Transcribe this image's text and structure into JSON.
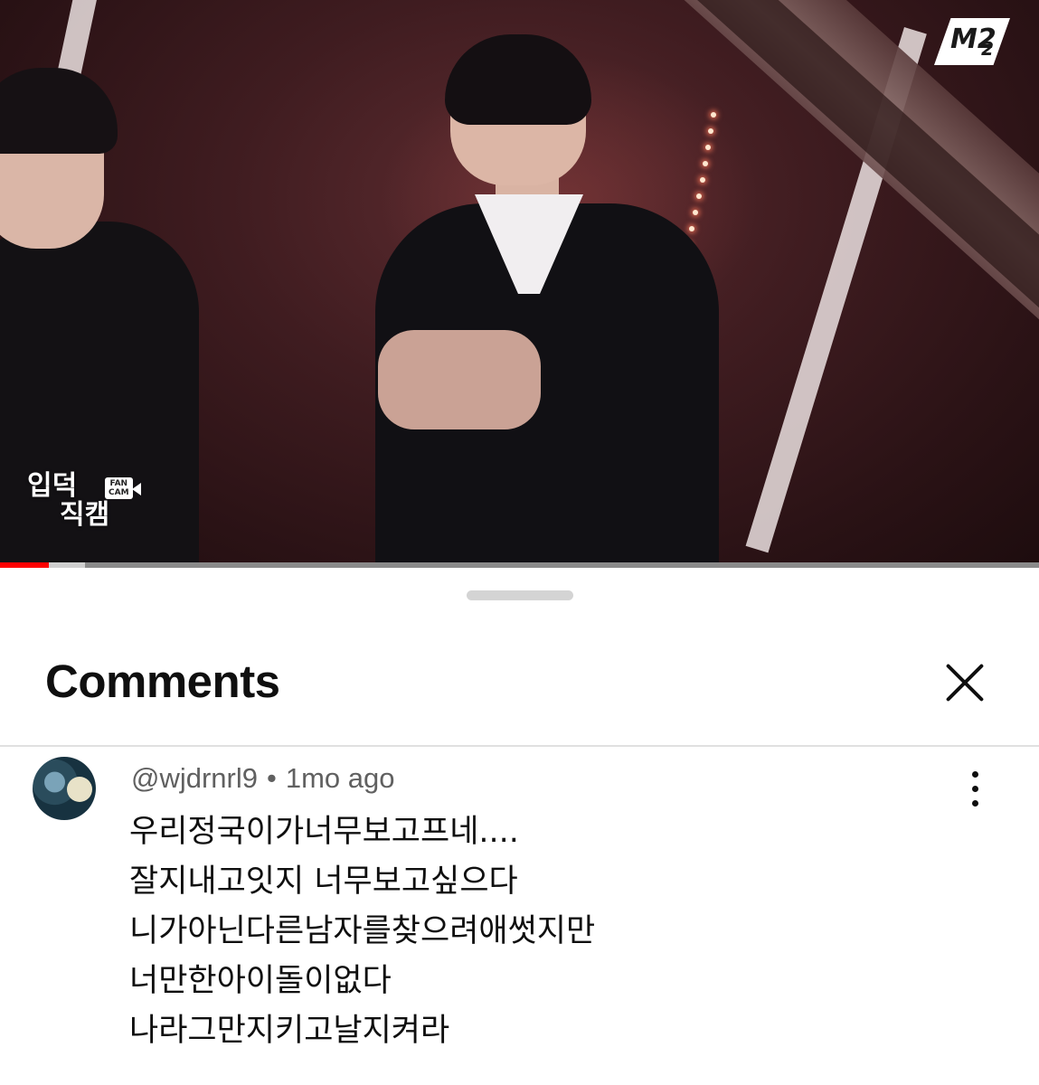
{
  "video": {
    "channel_logo": "M2",
    "channel_logo_sub": "2",
    "fancam_badge_line1": "입덕",
    "fancam_badge_line2": "직캠",
    "fancam_tag": "FAN CAM",
    "progress_fraction": 0.047,
    "progress_color": "#ff0000"
  },
  "comments_sheet": {
    "title": "Comments",
    "close_icon": "close-icon",
    "comments": [
      {
        "author": "@wjdrnrl9",
        "separator": "•",
        "time": "1mo ago",
        "more_icon": "more-vertical-icon",
        "lines": [
          "우리정국이가너무보고프네....",
          "잘지내고잇지 너무보고싶으다",
          "니가아닌다른남자를찾으려애썻지만",
          "너만한아이돌이없다",
          "나라그만지키고날지켜라"
        ]
      }
    ]
  }
}
